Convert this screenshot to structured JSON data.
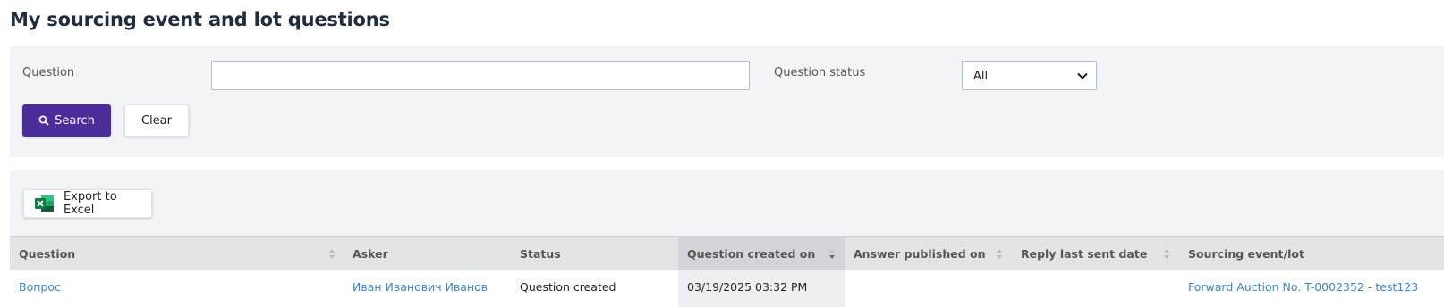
{
  "page": {
    "title": "My sourcing event and lot questions"
  },
  "filters": {
    "question_label": "Question",
    "question_value": "",
    "status_label": "Question status",
    "status_selected": "All",
    "search_label": "Search",
    "clear_label": "Clear"
  },
  "toolbar": {
    "export_label": "Export to Excel"
  },
  "table": {
    "columns": [
      "Question",
      "Asker",
      "Status",
      "Question created on",
      "Answer published on",
      "Reply last sent date",
      "Sourcing event/lot"
    ],
    "sorted_column": "Question created on",
    "sort_direction": "descending",
    "rows": [
      {
        "question": "Вопрос",
        "asker": "Иван Иванович Иванов",
        "status": "Question created",
        "created_on": "03/19/2025 03:32 PM",
        "answer_published_on": "",
        "reply_last_sent": "",
        "sourcing_event": "Forward Auction No. T-0002352 - test123"
      }
    ]
  },
  "colors": {
    "primary_button": "#4a2d98",
    "link": "#3b86d1",
    "panel_bg": "#f3f4f7",
    "header_bg": "#e3e4e8",
    "excel_green": "#1d6f42"
  }
}
